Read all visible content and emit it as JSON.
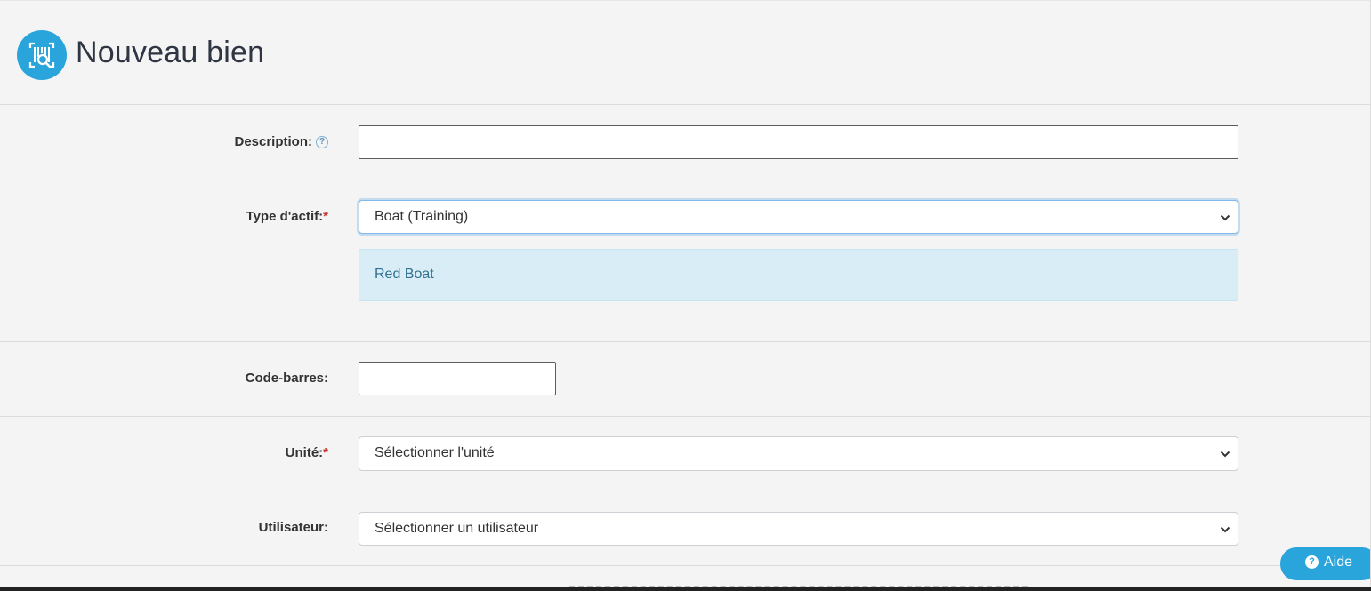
{
  "header": {
    "title": "Nouveau bien",
    "logo_icon": "barcode-search-icon"
  },
  "form": {
    "description": {
      "label": "Description:",
      "help_icon": "?",
      "value": ""
    },
    "asset_type": {
      "label": "Type d'actif:",
      "required_mark": "*",
      "selected": "Boat (Training)",
      "info_text": "Red Boat"
    },
    "barcode": {
      "label": "Code-barres:",
      "value": ""
    },
    "unit": {
      "label": "Unité:",
      "required_mark": "*",
      "selected": "Sélectionner l'unité"
    },
    "user": {
      "label": "Utilisateur:",
      "selected": "Sélectionner un utilisateur"
    }
  },
  "help_button": {
    "icon": "?",
    "label": "Aide"
  },
  "colors": {
    "accent": "#2aa5dc",
    "info_bg": "#d9edf7",
    "info_text": "#31708f",
    "required": "#c9302c"
  }
}
